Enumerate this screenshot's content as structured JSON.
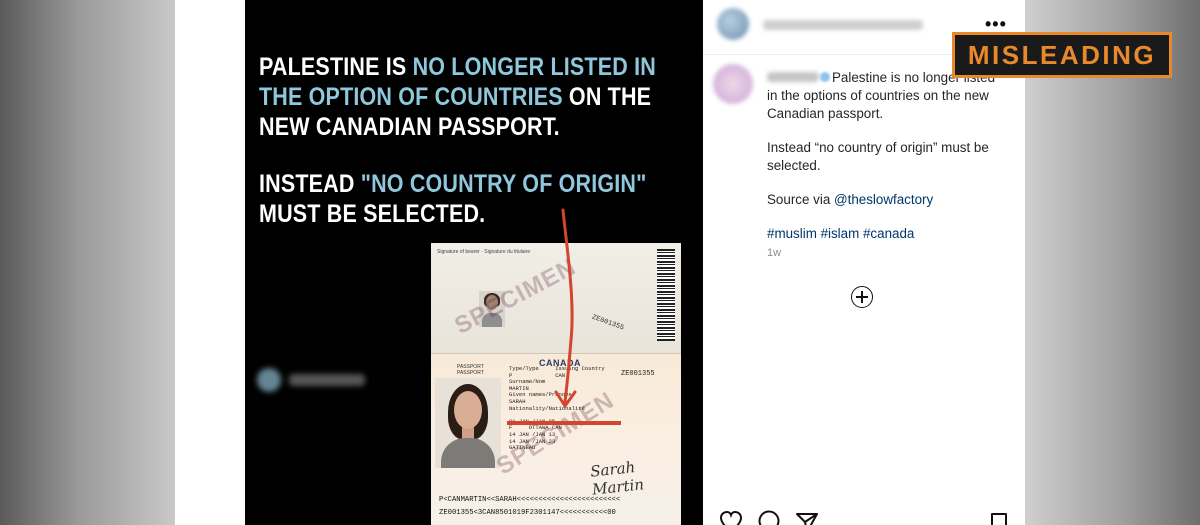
{
  "top_cutoff_text": "",
  "post_image": {
    "headline_line1_white": "PALESTINE IS ",
    "headline_line1_blue": "NO LONGER LISTED IN",
    "headline_line2_blue": "THE OPTION OF COUNTRIES",
    "headline_line2_white": " ON THE",
    "headline_line3": "NEW CANADIAN PASSPORT.",
    "headline_line4_white": "INSTEAD ",
    "headline_line4_blue": "\"NO COUNTRY OF ORIGIN\"",
    "headline_line5": "MUST BE SELECTED.",
    "passport": {
      "signature_label": "Signature of bearer · Signature du titulaire",
      "country": "CANADA",
      "type_label": "PASSPORT\nPASSPORT",
      "passport_number": "ZE001355",
      "fields": "Type/Type     Issuing Country\nP             CAN\nSurname/Nom\nMARTIN\nGiven names/Prénoms\nSARAH\nNationality/Nationalité\n\n01 JAN /JAN 85\nF     OTTAWA CAN\n14 JAN /JAN 13\n14 JAN /JAN 23\nGATINEAU",
      "signature": "Sarah Martin",
      "mrz_line1": "P<CANMARTIN<<SARAH<<<<<<<<<<<<<<<<<<<<<<<<",
      "mrz_line2": "ZE001355<3CAN8501019F2301147<<<<<<<<<<<00",
      "vertical_number": "ZE001355",
      "watermark": "SPECIMEN"
    }
  },
  "sidebar": {
    "more_icon": "more-options-icon",
    "caption_line1": "Palestine is no longer listed in the options of countries on the new Canadian passport.",
    "caption_line2": "Instead “no country of origin” must be selected.",
    "caption_source_prefix": "Source via ",
    "caption_mention": "@theslowfactory",
    "caption_tags": "#muslim #islam #canada",
    "time_ago": "1w",
    "add_comment_icon": "plus-circle-icon"
  },
  "actions": {
    "like_icon": "heart-icon",
    "comment_icon": "comment-icon",
    "share_icon": "send-icon",
    "save_icon": "bookmark-icon"
  },
  "badge": {
    "label": "MISLEADING",
    "color": "#e8892b"
  }
}
